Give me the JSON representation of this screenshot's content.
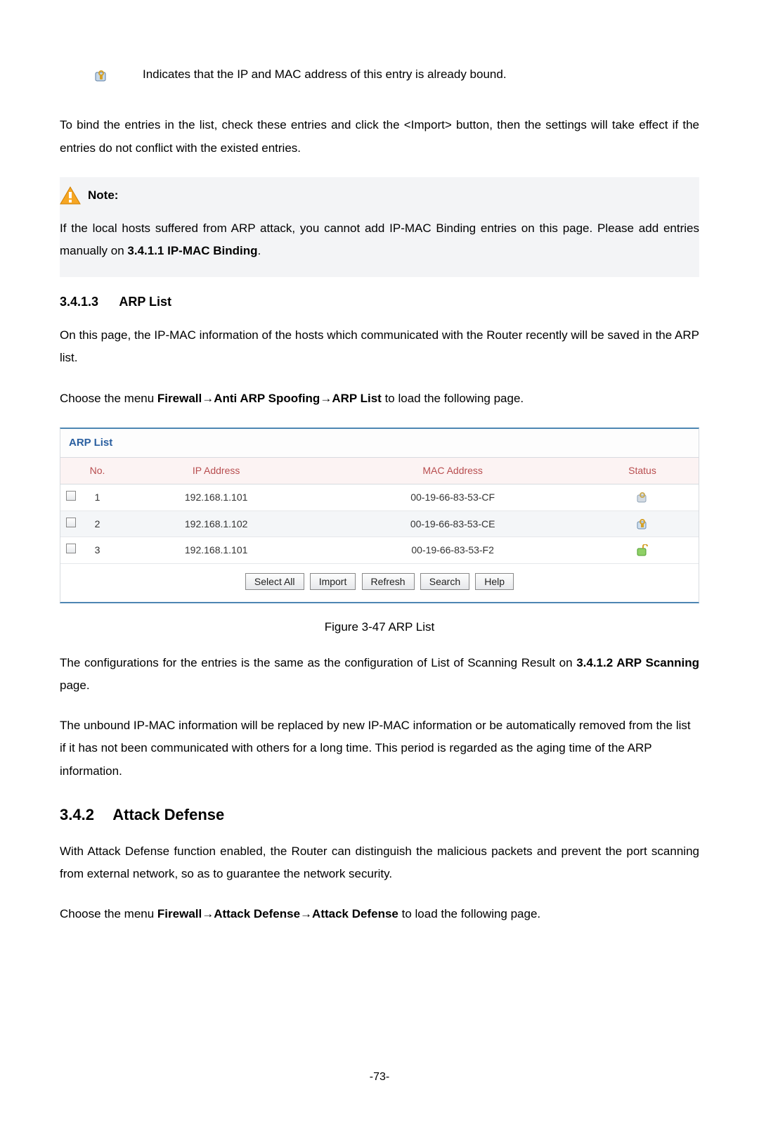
{
  "top": {
    "bound_desc": "Indicates that the IP and MAC address of this entry is already bound."
  },
  "para1": "To bind the entries in the list, check these entries and click the <Import> button, then the settings will take effect if the entries do not conflict with the existed entries.",
  "note": {
    "label": "Note:",
    "text_a": "If the local hosts suffered from ARP attack, you cannot add IP-MAC Binding entries on this page. Please add entries manually on ",
    "text_b": "3.4.1.1 IP-MAC Binding",
    "text_c": "."
  },
  "h3413": {
    "num": "3.4.1.3",
    "title": "ARP List"
  },
  "para_arp_intro": "On this page, the IP-MAC information of the hosts which communicated with the Router recently will be saved in the ARP list.",
  "menu1": {
    "a": "Choose the menu ",
    "b": "Firewall→Anti ARP Spoofing→ARP List",
    "c": " to load the following page."
  },
  "arp": {
    "title": "ARP List",
    "headers": {
      "no": "No.",
      "ip": "IP Address",
      "mac": "MAC Address",
      "status": "Status"
    },
    "rows": [
      {
        "no": "1",
        "ip": "192.168.1.101",
        "mac": "00-19-66-83-53-CF",
        "status": "bound-gray"
      },
      {
        "no": "2",
        "ip": "192.168.1.102",
        "mac": "00-19-66-83-53-CE",
        "status": "bound-yellow"
      },
      {
        "no": "3",
        "ip": "192.168.1.101",
        "mac": "00-19-66-83-53-F2",
        "status": "unbound-green"
      }
    ],
    "buttons": {
      "select_all": "Select All",
      "import": "Import",
      "refresh": "Refresh",
      "search": "Search",
      "help": "Help"
    }
  },
  "figure": "Figure 3-47 ARP List",
  "para2a": "The configurations for the entries is the same as the configuration of List of Scanning Result on ",
  "para2b": "3.4.1.2 ARP Scanning",
  "para2c": " page.",
  "para3": "The unbound IP-MAC information will be replaced by new IP-MAC information or be automatically removed from the list if it has not been communicated with others for a long time. This period is regarded as the aging time of the ARP information.",
  "h342": {
    "num": "3.4.2",
    "title": "Attack Defense"
  },
  "para4": "With Attack Defense function enabled, the Router can distinguish the malicious packets and prevent the port scanning from external network, so as to guarantee the network security.",
  "menu2": {
    "a": "Choose the menu ",
    "b": "Firewall→Attack Defense→Attack Defense",
    "c": " to load the following page."
  },
  "page_number": "-73-"
}
